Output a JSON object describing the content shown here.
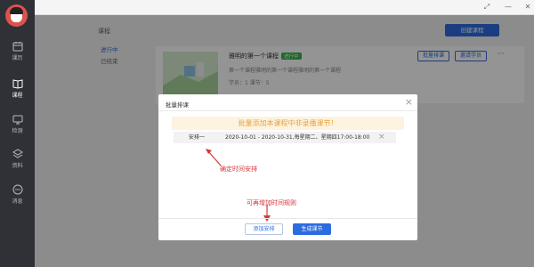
{
  "nav": {
    "items": [
      {
        "label": "课历",
        "icon": "calendar-icon"
      },
      {
        "label": "课程",
        "icon": "book-icon"
      },
      {
        "label": "检测",
        "icon": "monitor-icon"
      },
      {
        "label": "资料",
        "icon": "layers-icon"
      },
      {
        "label": "消息",
        "icon": "chat-icon"
      }
    ],
    "active": "课程"
  },
  "window": {
    "controls": [
      "restore-icon",
      "minimize-icon",
      "close-icon"
    ]
  },
  "main": {
    "breadcrumb": "课程",
    "create_button": "创建课程",
    "filters": [
      {
        "label": "进行中",
        "active": true
      },
      {
        "label": "已结束",
        "active": false
      }
    ],
    "course": {
      "title": "雅明的第一个课程",
      "status": "进行中",
      "description": "第一个课程雅明的第一个课程雅明的第一个课程",
      "meta": "学员：1 课节：5",
      "actions": [
        "批量排课",
        "邀请学员"
      ],
      "more": "···"
    }
  },
  "dialog": {
    "title": "批量排课",
    "close": "×",
    "notice": "批量添加本课程中非录播课节！",
    "schedule": {
      "day": "安排一",
      "range": "2020-10-01 - 2020-10-31,每星期二、星期四17:00-18:00",
      "remove": "×"
    },
    "annotation_time": "确定时间安排",
    "annotation_rule": "可再增加时间规则",
    "add_button": "添加安排",
    "generate_button": "生成课节"
  },
  "colors": {
    "accent": "#2d6cdf",
    "nav_bg": "#2f3136",
    "notice_text": "#e8a43a",
    "annotation": "#d9343a",
    "live_tag": "#37b34a"
  }
}
